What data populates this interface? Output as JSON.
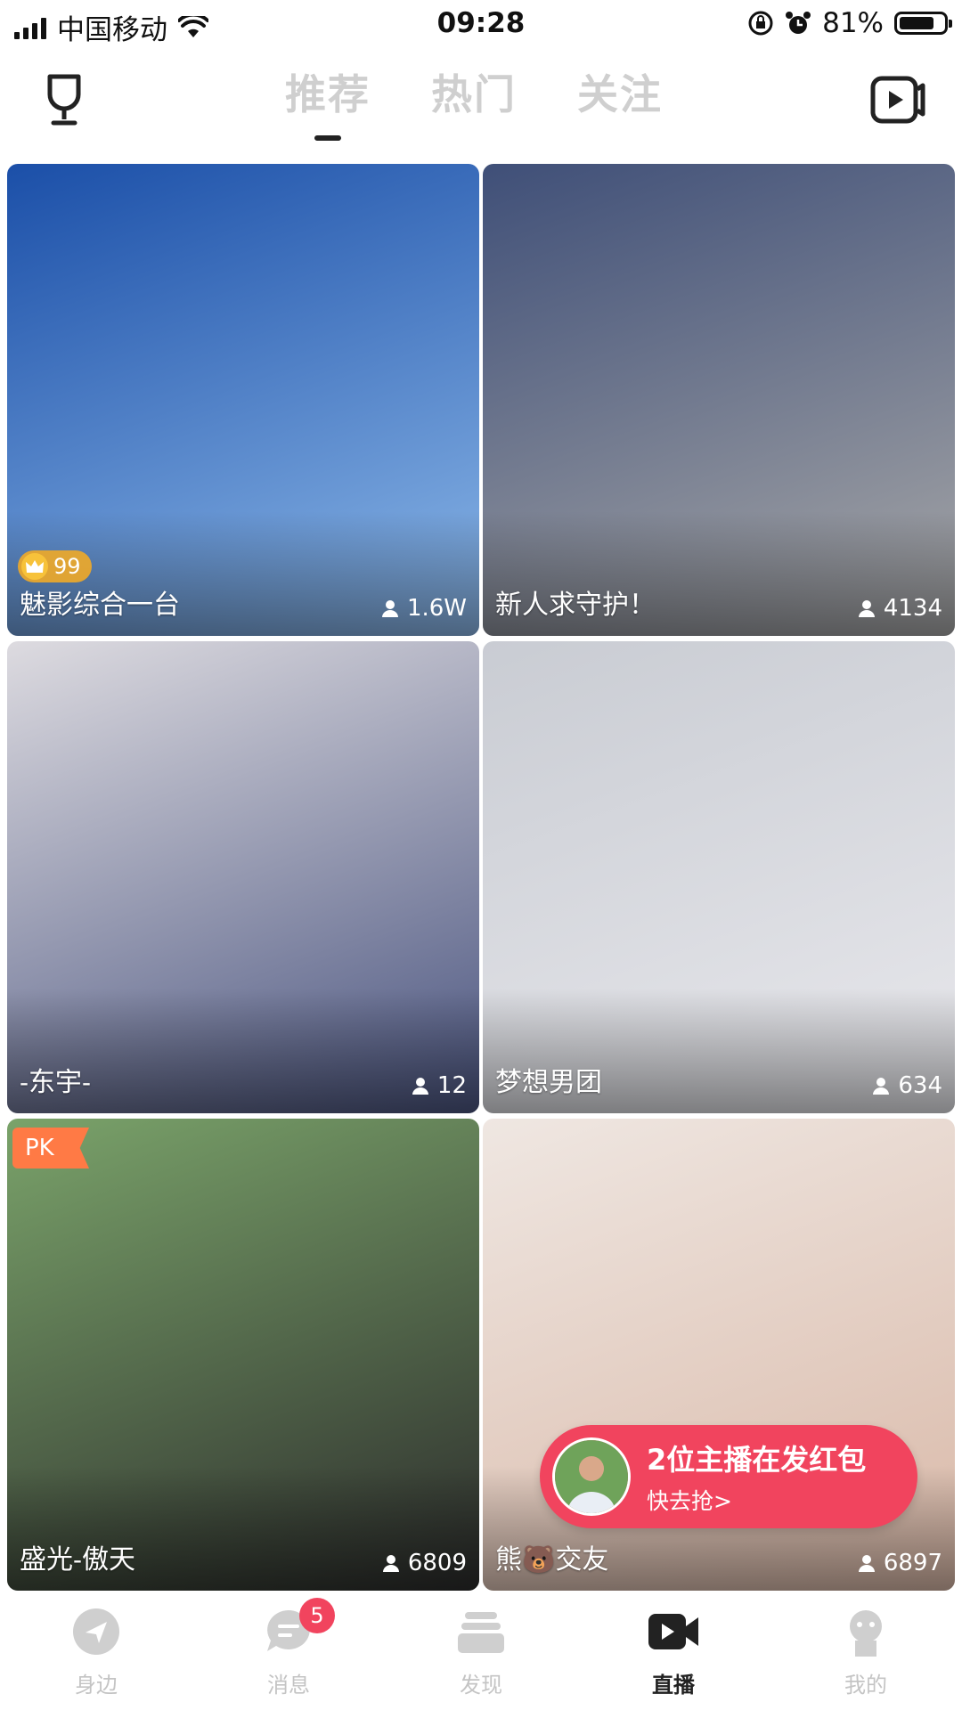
{
  "status_bar": {
    "carrier": "中国移动",
    "time": "09:28",
    "battery_text": "81%",
    "battery_level": 0.81
  },
  "header": {
    "left_icon": "trophy-icon",
    "right_icon": "live-video-icon",
    "tabs": [
      {
        "label": "推荐",
        "active": true
      },
      {
        "label": "热门",
        "active": false
      },
      {
        "label": "关注",
        "active": false
      }
    ]
  },
  "streams": [
    {
      "title": "魅影综合一台",
      "viewers": "1.6W",
      "badge_value": "99",
      "bg_colors": [
        "#1b4fa8",
        "#8bb7e8"
      ]
    },
    {
      "title": "新人求守护！",
      "viewers": "4134",
      "bg_colors": [
        "#3f4f78",
        "#a8a8a8"
      ]
    },
    {
      "title": "-东宇-",
      "viewers": "12",
      "bg_colors": [
        "#dddbe0",
        "#4b5580"
      ]
    },
    {
      "title": "梦想男团",
      "viewers": "634",
      "bg_colors": [
        "#c9ccd3",
        "#e8e8ec"
      ]
    },
    {
      "title": "盛光-傲天",
      "viewers": "6809",
      "badge_label": "PK",
      "bg_colors": [
        "#7aa36a",
        "#2b2b2b"
      ]
    },
    {
      "title": "熊🐻交友",
      "viewers": "6897",
      "bg_colors": [
        "#efe7e2",
        "#d9b8a7"
      ]
    }
  ],
  "red_packet": {
    "title": "2位主播在发红包",
    "subtitle": "快去抢>"
  },
  "bottom_nav": {
    "items": [
      {
        "label": "身边",
        "icon": "nearby-icon"
      },
      {
        "label": "消息",
        "icon": "message-icon",
        "badge": "5"
      },
      {
        "label": "发现",
        "icon": "discover-icon"
      },
      {
        "label": "直播",
        "icon": "live-icon",
        "active": true
      },
      {
        "label": "我的",
        "icon": "profile-icon"
      }
    ]
  },
  "colors": {
    "accent": "#f1445e",
    "pk_orange": "#ff7a45",
    "inactive_gray": "#c4c4c4"
  }
}
